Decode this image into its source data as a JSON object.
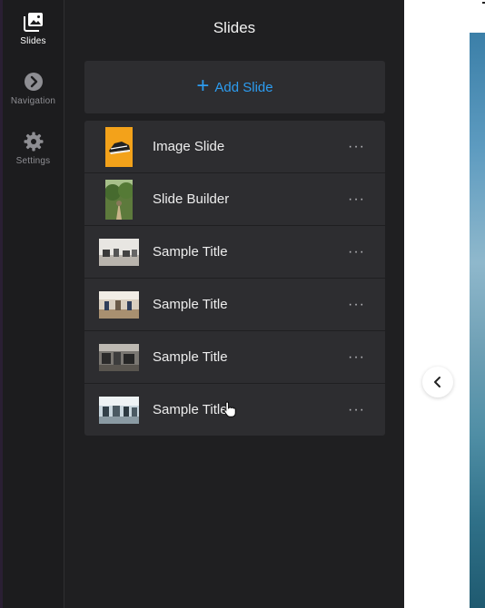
{
  "rail": {
    "items": [
      {
        "label": "Slides",
        "icon": "slides-icon",
        "active": true
      },
      {
        "label": "Navigation",
        "icon": "navigation-icon",
        "active": false
      },
      {
        "label": "Settings",
        "icon": "settings-icon",
        "active": false
      }
    ]
  },
  "panel": {
    "title": "Slides",
    "add_button": "Add Slide",
    "slides": [
      {
        "label": "Image Slide",
        "thumb": "sneaker-orange",
        "menu": "···"
      },
      {
        "label": "Slide Builder",
        "thumb": "forest-path",
        "menu": "···"
      },
      {
        "label": "Sample Title",
        "thumb": "gym-1",
        "menu": "···"
      },
      {
        "label": "Sample Title",
        "thumb": "gym-2",
        "menu": "···"
      },
      {
        "label": "Sample Title",
        "thumb": "gym-3",
        "menu": "···"
      },
      {
        "label": "Sample Title",
        "thumb": "gym-4",
        "menu": "···"
      }
    ]
  },
  "colors": {
    "accent": "#2d9cf0",
    "rail_bg": "#1c1c1e",
    "panel_bg": "#1f1f21",
    "card_bg": "#2d2d30"
  }
}
